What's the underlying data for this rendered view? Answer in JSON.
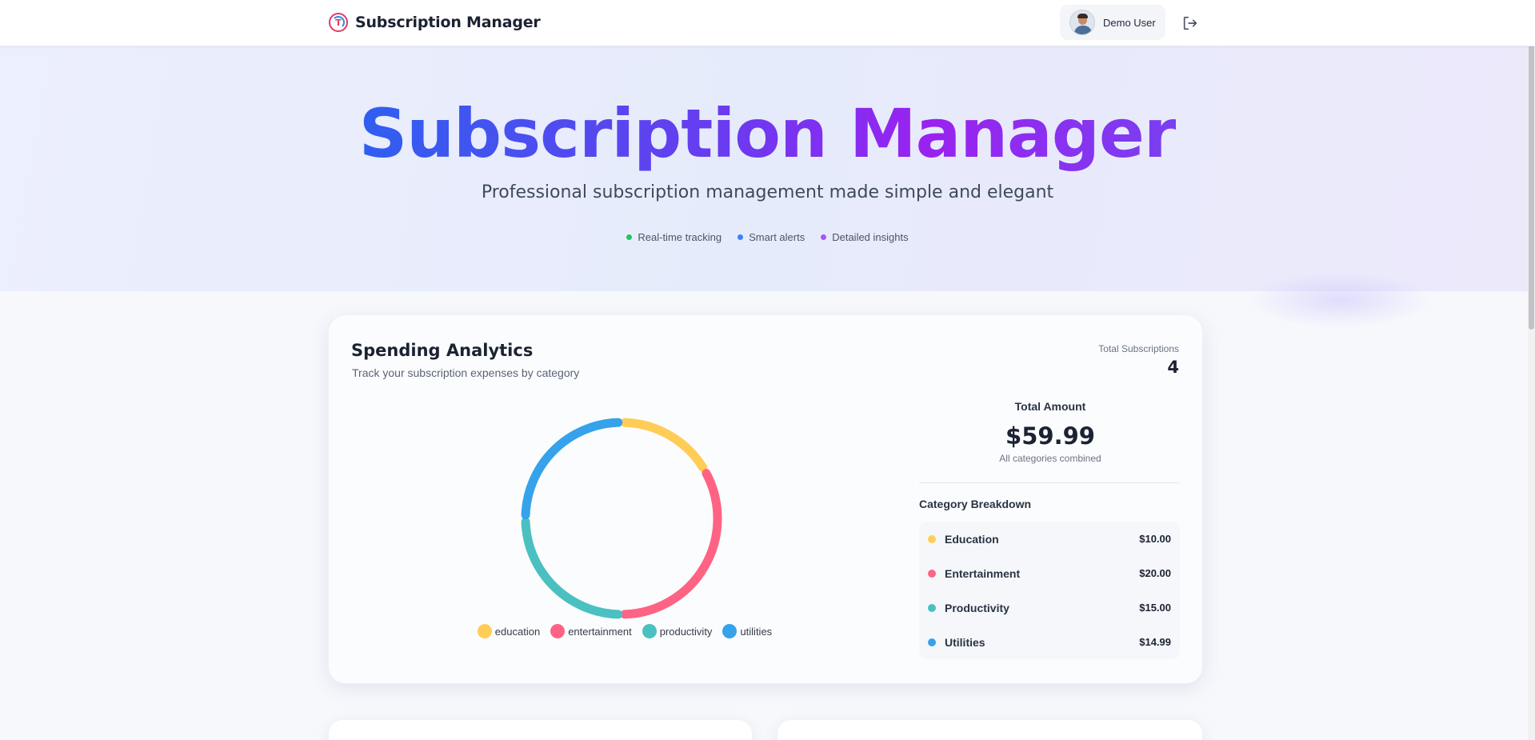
{
  "nav": {
    "brand_logo_letter": "T",
    "brand_name": "Subscription Manager",
    "user_name": "Demo User"
  },
  "hero": {
    "title": "Subscription Manager",
    "subtitle": "Professional subscription management made simple and elegant",
    "tags": [
      {
        "label": "Real-time tracking",
        "color": "#22c55e"
      },
      {
        "label": "Smart alerts",
        "color": "#3b82f6"
      },
      {
        "label": "Detailed insights",
        "color": "#a855f7"
      }
    ]
  },
  "analytics": {
    "title": "Spending Analytics",
    "subtitle": "Track your subscription expenses by category",
    "total_subscriptions_label": "Total Subscriptions",
    "total_subscriptions_value": "4",
    "total_amount_label": "Total Amount",
    "total_amount_value": "$59.99",
    "total_amount_note": "All categories combined",
    "breakdown_title": "Category Breakdown",
    "breakdown": [
      {
        "name": "Education",
        "amount": "$10.00",
        "color": "#ffcd56"
      },
      {
        "name": "Entertainment",
        "amount": "$20.00",
        "color": "#ff6384"
      },
      {
        "name": "Productivity",
        "amount": "$15.00",
        "color": "#4bc0c0"
      },
      {
        "name": "Utilities",
        "amount": "$14.99",
        "color": "#36a2eb"
      }
    ]
  },
  "chart_data": {
    "type": "pie",
    "variant": "doughnut",
    "categories": [
      "education",
      "entertainment",
      "productivity",
      "utilities"
    ],
    "values": [
      10.0,
      20.0,
      15.0,
      14.99
    ],
    "colors": [
      "#ffcd56",
      "#ff6384",
      "#4bc0c0",
      "#36a2eb"
    ],
    "legend_position": "bottom"
  }
}
